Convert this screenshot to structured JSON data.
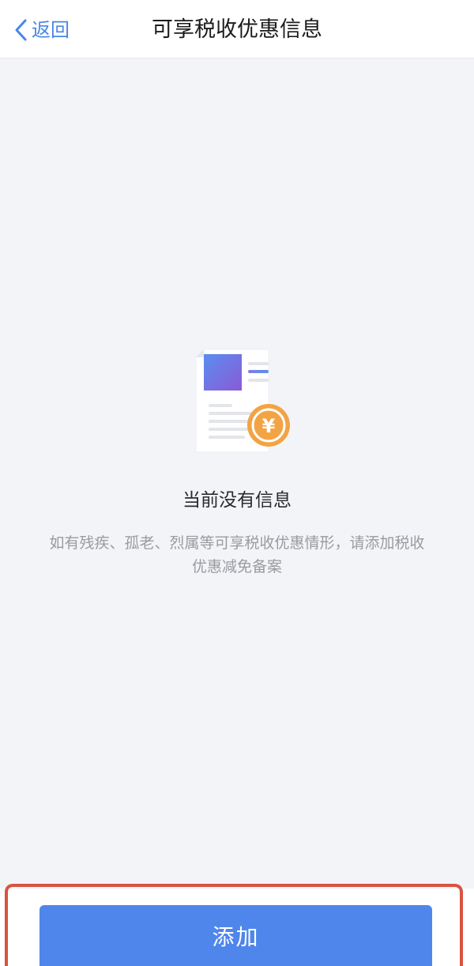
{
  "header": {
    "back_label": "返回",
    "back_icon": "chevron-left-icon",
    "title": "可享税收优惠信息"
  },
  "empty_state": {
    "illustration_icon": "document-yuan-coin-icon",
    "title": "当前没有信息",
    "description": "如有残疾、孤老、烈属等可享税收优惠情形，请添加税收优惠减免备案"
  },
  "footer": {
    "add_label": "添加"
  },
  "colors": {
    "accent": "#4a86e8",
    "button": "#4f86eb",
    "background": "#f3f4f8",
    "coin": "#f2a444",
    "highlight_outline": "#d9533f"
  }
}
